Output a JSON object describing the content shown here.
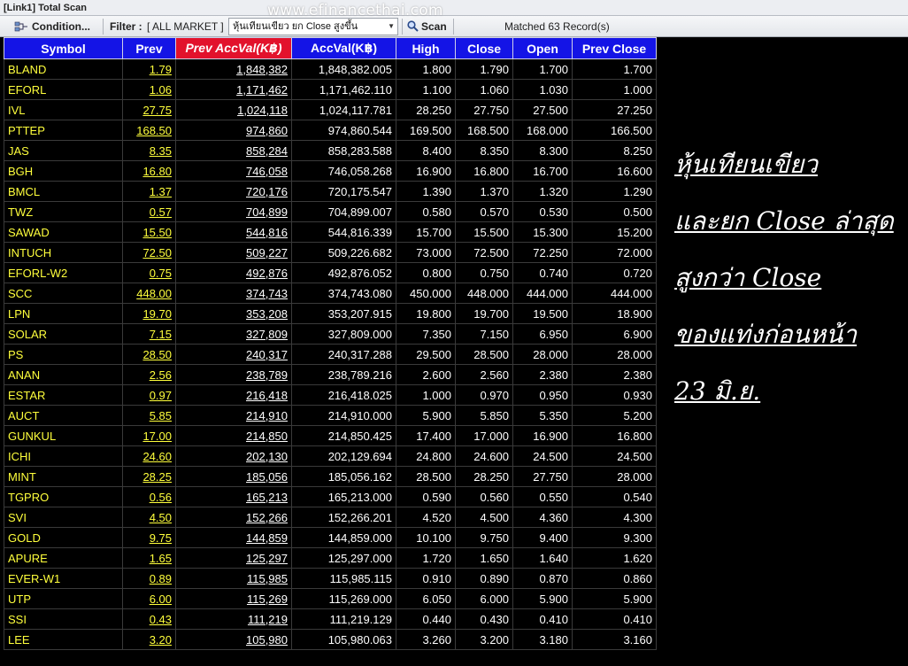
{
  "window": {
    "title": "[Link1] Total Scan"
  },
  "toolbar": {
    "condition_label": "Condition...",
    "filter_label": "Filter :",
    "filter_value": "[ ALL MARKET ]",
    "scan_selected": "หุ้นเทียนเขียว ยก Close สูงขึ้น",
    "scan_label": "Scan",
    "matched": "Matched 63 Record(s)"
  },
  "watermark": "www.efinancethai.com",
  "table": {
    "columns": [
      "Symbol",
      "Prev",
      "Prev AccVal(K฿)",
      "AccVal(K฿)",
      "High",
      "Close",
      "Open",
      "Prev Close"
    ],
    "rows": [
      [
        "BLAND",
        "1.79",
        "1,848,382",
        "1,848,382.005",
        "1.800",
        "1.790",
        "1.700",
        "1.700"
      ],
      [
        "EFORL",
        "1.06",
        "1,171,462",
        "1,171,462.110",
        "1.100",
        "1.060",
        "1.030",
        "1.000"
      ],
      [
        "IVL",
        "27.75",
        "1,024,118",
        "1,024,117.781",
        "28.250",
        "27.750",
        "27.500",
        "27.250"
      ],
      [
        "PTTEP",
        "168.50",
        "974,860",
        "974,860.544",
        "169.500",
        "168.500",
        "168.000",
        "166.500"
      ],
      [
        "JAS",
        "8.35",
        "858,284",
        "858,283.588",
        "8.400",
        "8.350",
        "8.300",
        "8.250"
      ],
      [
        "BGH",
        "16.80",
        "746,058",
        "746,058.268",
        "16.900",
        "16.800",
        "16.700",
        "16.600"
      ],
      [
        "BMCL",
        "1.37",
        "720,176",
        "720,175.547",
        "1.390",
        "1.370",
        "1.320",
        "1.290"
      ],
      [
        "TWZ",
        "0.57",
        "704,899",
        "704,899.007",
        "0.580",
        "0.570",
        "0.530",
        "0.500"
      ],
      [
        "SAWAD",
        "15.50",
        "544,816",
        "544,816.339",
        "15.700",
        "15.500",
        "15.300",
        "15.200"
      ],
      [
        "INTUCH",
        "72.50",
        "509,227",
        "509,226.682",
        "73.000",
        "72.500",
        "72.250",
        "72.000"
      ],
      [
        "EFORL-W2",
        "0.75",
        "492,876",
        "492,876.052",
        "0.800",
        "0.750",
        "0.740",
        "0.720"
      ],
      [
        "SCC",
        "448.00",
        "374,743",
        "374,743.080",
        "450.000",
        "448.000",
        "444.000",
        "444.000"
      ],
      [
        "LPN",
        "19.70",
        "353,208",
        "353,207.915",
        "19.800",
        "19.700",
        "19.500",
        "18.900"
      ],
      [
        "SOLAR",
        "7.15",
        "327,809",
        "327,809.000",
        "7.350",
        "7.150",
        "6.950",
        "6.900"
      ],
      [
        "PS",
        "28.50",
        "240,317",
        "240,317.288",
        "29.500",
        "28.500",
        "28.000",
        "28.000"
      ],
      [
        "ANAN",
        "2.56",
        "238,789",
        "238,789.216",
        "2.600",
        "2.560",
        "2.380",
        "2.380"
      ],
      [
        "ESTAR",
        "0.97",
        "216,418",
        "216,418.025",
        "1.000",
        "0.970",
        "0.950",
        "0.930"
      ],
      [
        "AUCT",
        "5.85",
        "214,910",
        "214,910.000",
        "5.900",
        "5.850",
        "5.350",
        "5.200"
      ],
      [
        "GUNKUL",
        "17.00",
        "214,850",
        "214,850.425",
        "17.400",
        "17.000",
        "16.900",
        "16.800"
      ],
      [
        "ICHI",
        "24.60",
        "202,130",
        "202,129.694",
        "24.800",
        "24.600",
        "24.500",
        "24.500"
      ],
      [
        "MINT",
        "28.25",
        "185,056",
        "185,056.162",
        "28.500",
        "28.250",
        "27.750",
        "28.000"
      ],
      [
        "TGPRO",
        "0.56",
        "165,213",
        "165,213.000",
        "0.590",
        "0.560",
        "0.550",
        "0.540"
      ],
      [
        "SVI",
        "4.50",
        "152,266",
        "152,266.201",
        "4.520",
        "4.500",
        "4.360",
        "4.300"
      ],
      [
        "GOLD",
        "9.75",
        "144,859",
        "144,859.000",
        "10.100",
        "9.750",
        "9.400",
        "9.300"
      ],
      [
        "APURE",
        "1.65",
        "125,297",
        "125,297.000",
        "1.720",
        "1.650",
        "1.640",
        "1.620"
      ],
      [
        "EVER-W1",
        "0.89",
        "115,985",
        "115,985.115",
        "0.910",
        "0.890",
        "0.870",
        "0.860"
      ],
      [
        "UTP",
        "6.00",
        "115,269",
        "115,269.000",
        "6.050",
        "6.000",
        "5.900",
        "5.900"
      ],
      [
        "SSI",
        "0.43",
        "111,219",
        "111,219.129",
        "0.440",
        "0.430",
        "0.410",
        "0.410"
      ],
      [
        "LEE",
        "3.20",
        "105,980",
        "105,980.063",
        "3.260",
        "3.200",
        "3.180",
        "3.160"
      ]
    ]
  },
  "note_lines": [
    "หุ้นเทียนเขียว",
    "และยก Close ล่าสุด",
    "สูงกว่า Close",
    "ของแท่งก่อนหน้า",
    "23 มิ.ย."
  ],
  "colors": {
    "header": "#1414e6",
    "active_header": "#e2122c",
    "symbol": "#ffff3c"
  }
}
